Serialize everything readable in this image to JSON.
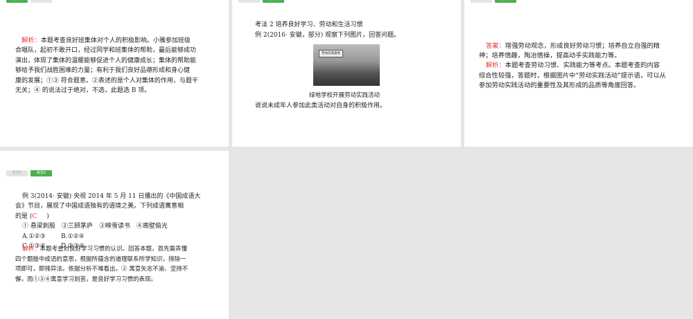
{
  "tabs": [
    "考法1",
    "考法2"
  ],
  "slide1": {
    "label": "解析：",
    "lines": [
      "本题考查良好班集体对个人的积极影响。小雅参加班级",
      "合唱队，起初不敢开口，经过同学和班集体的帮助，最后能够成功",
      "演出，体现了集体的温暖能够促进个人的健康成长；集体的帮助能",
      "够给予我们战胜困难的力量；有利于我们良好品德形成和身心健",
      "康的发展；①③ 符合题意。②表述的是个人对集体的作用，与题干",
      "无关；④ 的说法过于绝对，不选，此题选 B 项。"
    ]
  },
  "slide2": {
    "heading": "考法 2 培养良好学习、劳动和生活习惯",
    "example": "例 2(2016· 安徽，部分) 观察下列图片，回答问题。",
    "sign": "劳动实践基地",
    "caption": "绿地学校开展劳动实践活动",
    "question": "说说未成年人参加此类活动对自身的积极作用。"
  },
  "slide3": {
    "answer_label": "答案：",
    "answer_lines": [
      "增强劳动观念，形成良好劳动习惯；培养自立自强的精",
      "神；培养情趣，陶冶情操，提高动手实践能力等。"
    ],
    "analysis_label": "解析：",
    "analysis_lines": [
      "本题考查劳动习惯、实践能力等考点。本题考查的内容",
      "综合性较强，答题时，根据图片中“劳动实践活动”提示语，可以从",
      "参加劳动实践活动的重要性及其形成的品质等角度回答。"
    ]
  },
  "slide4": {
    "q_lines": [
      "例 3(2014· 安徽) 央视 2014 年 5 月 11 日播出的《中国成语大",
      "会》节目，展现了中国成语独有的语境之美。下列成语寓意相"
    ],
    "q_end": "的是 (",
    "answer": "C",
    "close": ")",
    "items": "① 悬梁刺股　②三顾茅庐　③映雪读书　④凿壁偷光",
    "optA": "A.①②③",
    "optB": "B.①②④",
    "optC": "C.①③④",
    "optD": "D.②③④",
    "analysis_label": "解析：",
    "analysis_lines": [
      "本题考查对良好学习习惯的认识。回答本题，首先需弄懂",
      "四个题肢中成语的意思，根据所蕴含的道理联系所学知识，排除一",
      "项即可，即排异法。依据分析不难看出，② 寓意矢志不渝、坚持不",
      "懈，而①③④寓意学习刻苦，是良好学习习惯的表现。"
    ]
  }
}
